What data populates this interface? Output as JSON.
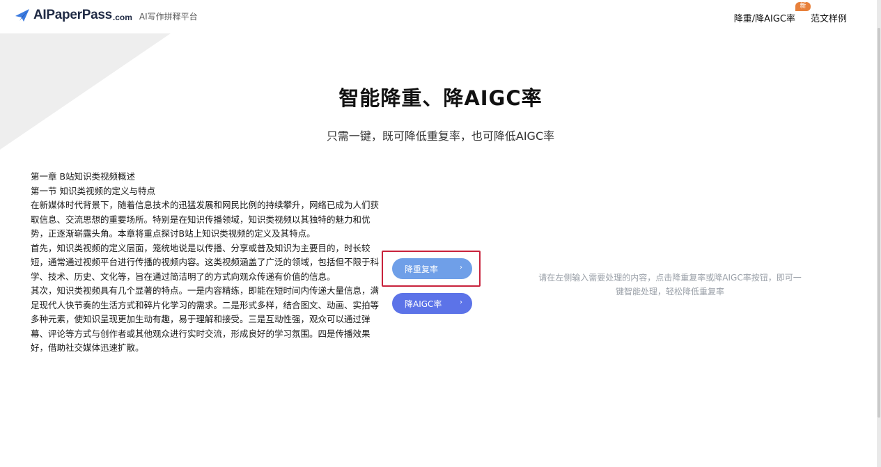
{
  "header": {
    "logo_text": "AIPaperPass",
    "logo_domain": ".com",
    "logo_tagline": "AI写作拼释平台",
    "nav": [
      {
        "label": "降重/降AIGC率",
        "badge": "新"
      },
      {
        "label": "范文样例"
      }
    ]
  },
  "hero": {
    "title": "智能降重、降AIGC率",
    "subtitle": "只需一键，既可降低重复率，也可降低AIGC率"
  },
  "input_text": {
    "lines": [
      "第一章 B站知识类视频概述",
      "第一节 知识类视频的定义与特点",
      "在新媒体时代背景下，随着信息技术的迅猛发展和网民比例的持续攀升，网络已成为人们获取信息、交流思想的重要场所。特别是在知识传播领域，知识类视频以其独特的魅力和优势，正逐渐崭露头角。本章将重点探讨B站上知识类视频的定义及其特点。",
      "首先，知识类视频的定义层面，笼统地说是以传播、分享或普及知识为主要目的，时长较短，通常通过视频平台进行传播的视频内容。这类视频涵盖了广泛的领域，包括但不限于科学、技术、历史、文化等，旨在通过简洁明了的方式向观众传递有价值的信息。",
      "其次，知识类视频具有几个显著的特点。一是内容精练，即能在短时间内传递大量信息，满足现代人快节奏的生活方式和碎片化学习的需求。二是形式多样，结合图文、动画、实拍等多种元素，使知识呈现更加生动有趣，易于理解和接受。三是互动性强，观众可以通过弹幕、评论等方式与创作者或其他观众进行实时交流，形成良好的学习氛围。四是传播效果好，借助社交媒体迅速扩散。"
    ]
  },
  "actions": {
    "reduce_label": "降重复率",
    "aigc_label": "降AIGC率",
    "chevron": "›"
  },
  "result": {
    "hint": "请在左侧输入需要处理的内容，点击降重复率或降AIGC率按钮，即可一键智能处理，轻松降低重复率"
  },
  "colors": {
    "reduce_button": "#6f9fe8",
    "aigc_button": "#5c73e8",
    "highlight_border": "#c8223c",
    "badge": "#e8803a"
  }
}
